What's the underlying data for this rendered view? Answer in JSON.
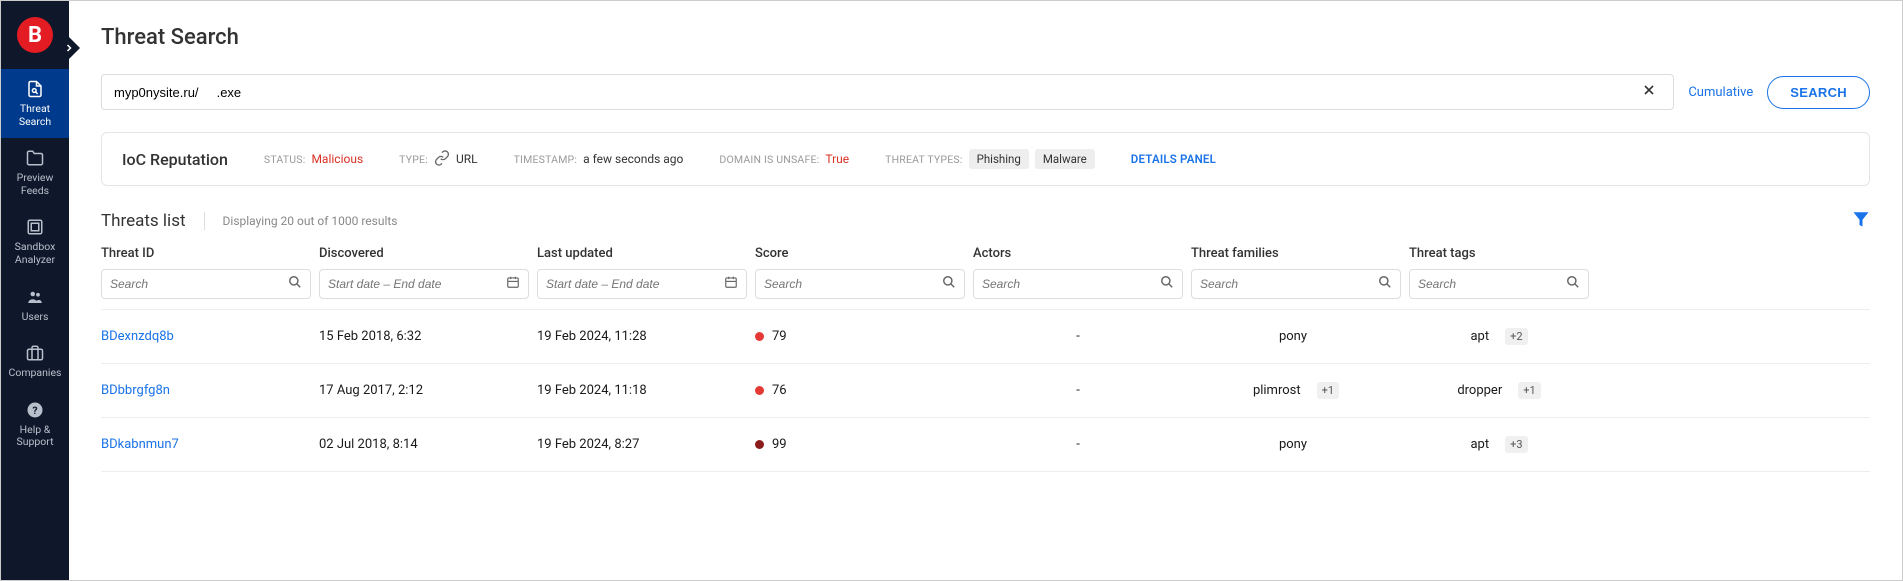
{
  "sidebar": {
    "items": [
      {
        "label": "Threat Search"
      },
      {
        "label": "Preview Feeds"
      },
      {
        "label": "Sandbox Analyzer"
      },
      {
        "label": "Users"
      },
      {
        "label": "Companies"
      },
      {
        "label": "Help & Support"
      }
    ]
  },
  "page": {
    "title": "Threat Search"
  },
  "search": {
    "value": "myp0nysite.ru/     .exe",
    "cumulative": "Cumulative",
    "button": "SEARCH"
  },
  "reputation": {
    "title": "IoC Reputation",
    "status_label": "STATUS:",
    "status_value": "Malicious",
    "type_label": "TYPE:",
    "type_value": "URL",
    "timestamp_label": "TIMESTAMP:",
    "timestamp_value": "a few seconds ago",
    "domain_unsafe_label": "DOMAIN IS UNSAFE:",
    "domain_unsafe_value": "True",
    "threat_types_label": "THREAT TYPES:",
    "threat_types": [
      "Phishing",
      "Malware"
    ],
    "details_link": "DETAILS PANEL"
  },
  "threats": {
    "title": "Threats list",
    "count_text": "Displaying 20 out of 1000 results",
    "columns": {
      "id": "Threat ID",
      "discovered": "Discovered",
      "updated": "Last updated",
      "score": "Score",
      "actors": "Actors",
      "families": "Threat families",
      "tags": "Threat tags"
    },
    "placeholders": {
      "search": "Search",
      "daterange": "Start date – End date"
    },
    "rows": [
      {
        "id": "BDexnzdq8b",
        "discovered": "15 Feb 2018, 6:32",
        "updated": "19 Feb 2024, 11:28",
        "score": "79",
        "score_color": "#e53935",
        "actors": "-",
        "family": "pony",
        "family_more": "",
        "tag": "apt",
        "tag_more": "+2"
      },
      {
        "id": "BDbbrgfg8n",
        "discovered": "17 Aug 2017, 2:12",
        "updated": "19 Feb 2024, 11:18",
        "score": "76",
        "score_color": "#e53935",
        "actors": "-",
        "family": "plimrost",
        "family_more": "+1",
        "tag": "dropper",
        "tag_more": "+1"
      },
      {
        "id": "BDkabnmun7",
        "discovered": "02 Jul 2018, 8:14",
        "updated": "19 Feb 2024, 8:27",
        "score": "99",
        "score_color": "#8b1a1a",
        "actors": "-",
        "family": "pony",
        "family_more": "",
        "tag": "apt",
        "tag_more": "+3"
      }
    ]
  }
}
